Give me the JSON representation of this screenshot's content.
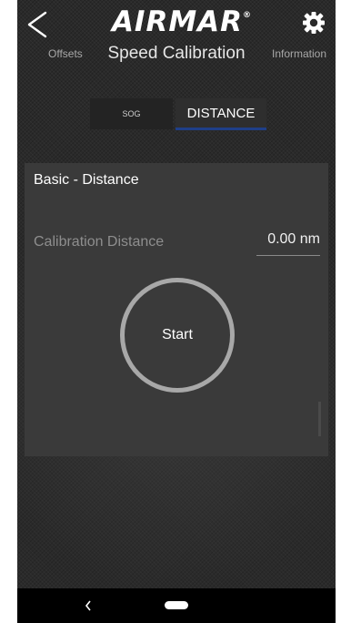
{
  "header": {
    "logo_text": "AIRMAR",
    "logo_mark": "®",
    "back_icon": "chevron-left-icon",
    "settings_icon": "gear-icon",
    "nav_left": "Offsets",
    "title": "Speed Calibration",
    "nav_right": "Information"
  },
  "tabs": [
    {
      "label": "SOG",
      "active": false
    },
    {
      "label": "DISTANCE",
      "active": true
    }
  ],
  "card": {
    "title": "Basic - Distance",
    "calibration_label": "Calibration Distance",
    "calibration_value": "0.00 nm",
    "start_label": "Start"
  },
  "system_nav": {
    "back_icon": "back-chevron-icon",
    "home_icon": "home-pill-icon"
  },
  "colors": {
    "background": "#2a2a2a",
    "card": "#3a3a3a",
    "accent_underline": "#1f3f88",
    "ring": "#a8a8a8"
  }
}
